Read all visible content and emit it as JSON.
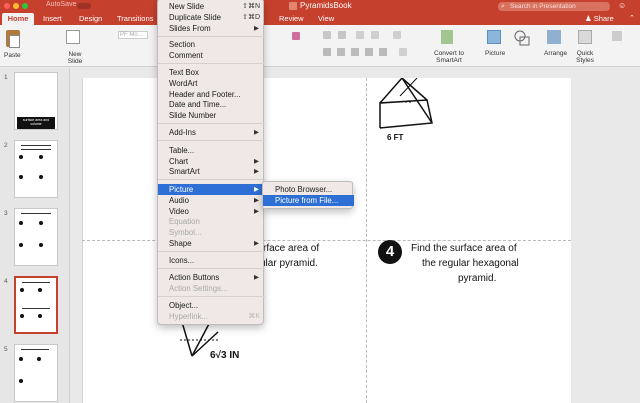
{
  "window": {
    "autosave_label": "AutoSave",
    "autosave_state": "OFF",
    "doc_title": "PyramidsBook",
    "search_placeholder": "Search in Presentation",
    "search_icon": "magnifier-icon",
    "smiley_icon": "smiley-icon"
  },
  "tabs": {
    "home": "Home",
    "insert": "Insert",
    "design": "Design",
    "transitions": "Transitions",
    "review": "Review",
    "view": "View",
    "share": "Share"
  },
  "ribbon": {
    "paste": "Paste",
    "new_slide": "New Slide",
    "font_placeholder": "PF Mo...",
    "convert": "Convert to SmartArt",
    "picture": "Picture",
    "arrange": "Arrange",
    "quick_styles": "Quick Styles"
  },
  "slides": {
    "numbers": [
      "1",
      "2",
      "3",
      "4",
      "5"
    ],
    "selected": "4",
    "thumb1_title": "surface area and volume"
  },
  "slide": {
    "p3_line1": "rface area of",
    "p3_line2": "ular pyramid.",
    "p3_measure": "6√3  IN",
    "p2_measure": "6 FT",
    "p4_badge": "4",
    "p4_line1": "Find the surface area of",
    "p4_line2": "the regular hexagonal",
    "p4_line3": "pyramid."
  },
  "insert_menu": {
    "new_slide": {
      "label": "New Slide",
      "shortcut": "⇧⌘N"
    },
    "duplicate_slide": {
      "label": "Duplicate Slide",
      "shortcut": "⇧⌘D"
    },
    "slides_from": {
      "label": "Slides From"
    },
    "section": {
      "label": "Section"
    },
    "comment": {
      "label": "Comment"
    },
    "text_box": {
      "label": "Text Box"
    },
    "wordart": {
      "label": "WordArt"
    },
    "header_footer": {
      "label": "Header and Footer..."
    },
    "date_time": {
      "label": "Date and Time..."
    },
    "slide_number": {
      "label": "Slide Number"
    },
    "add_ins": {
      "label": "Add-Ins"
    },
    "table": {
      "label": "Table..."
    },
    "chart": {
      "label": "Chart"
    },
    "smartart": {
      "label": "SmartArt"
    },
    "picture": {
      "label": "Picture"
    },
    "audio": {
      "label": "Audio"
    },
    "video": {
      "label": "Video"
    },
    "equation": {
      "label": "Equation"
    },
    "symbol": {
      "label": "Symbol..."
    },
    "shape": {
      "label": "Shape"
    },
    "icons": {
      "label": "Icons..."
    },
    "action_buttons": {
      "label": "Action Buttons"
    },
    "action_settings": {
      "label": "Action Settings..."
    },
    "object": {
      "label": "Object..."
    },
    "hyperlink": {
      "label": "Hyperlink...",
      "shortcut": "⌘K"
    }
  },
  "picture_submenu": {
    "photo_browser": "Photo Browser...",
    "picture_from_file": "Picture from File..."
  },
  "colors": {
    "accent": "#c6402e",
    "menu_highlight": "#2e6fd6",
    "menu_bg": "#efe8e6"
  }
}
